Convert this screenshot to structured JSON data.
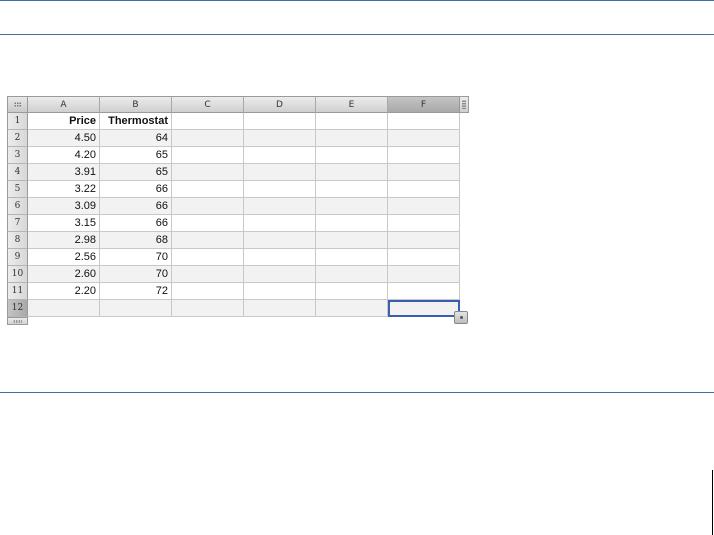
{
  "spreadsheet": {
    "columns": [
      "A",
      "B",
      "C",
      "D",
      "E",
      "F"
    ],
    "selected_column": "F",
    "selected_row": 12,
    "row_numbers": [
      "1",
      "2",
      "3",
      "4",
      "5",
      "6",
      "7",
      "8",
      "9",
      "10",
      "11",
      "12"
    ],
    "rows": [
      [
        "Price",
        "Thermostat",
        "",
        "",
        "",
        ""
      ],
      [
        "4.50",
        "64",
        "",
        "",
        "",
        ""
      ],
      [
        "4.20",
        "65",
        "",
        "",
        "",
        ""
      ],
      [
        "3.91",
        "65",
        "",
        "",
        "",
        ""
      ],
      [
        "3.22",
        "66",
        "",
        "",
        "",
        ""
      ],
      [
        "3.09",
        "66",
        "",
        "",
        "",
        ""
      ],
      [
        "3.15",
        "66",
        "",
        "",
        "",
        ""
      ],
      [
        "2.98",
        "68",
        "",
        "",
        "",
        ""
      ],
      [
        "2.56",
        "70",
        "",
        "",
        "",
        ""
      ],
      [
        "2.60",
        "70",
        "",
        "",
        "",
        ""
      ],
      [
        "2.20",
        "72",
        "",
        "",
        "",
        ""
      ],
      [
        "",
        "",
        "",
        "",
        "",
        ""
      ]
    ],
    "icons": {
      "corner": "grip-icon",
      "column_resize": "resize-handle-icon",
      "row_resize": "resize-handle-icon",
      "table_resize": "table-resize-icon"
    },
    "colors": {
      "rule": "#3f6ea3",
      "selection": "#3a5fb0",
      "alt_row": "#f2f2f2"
    }
  }
}
